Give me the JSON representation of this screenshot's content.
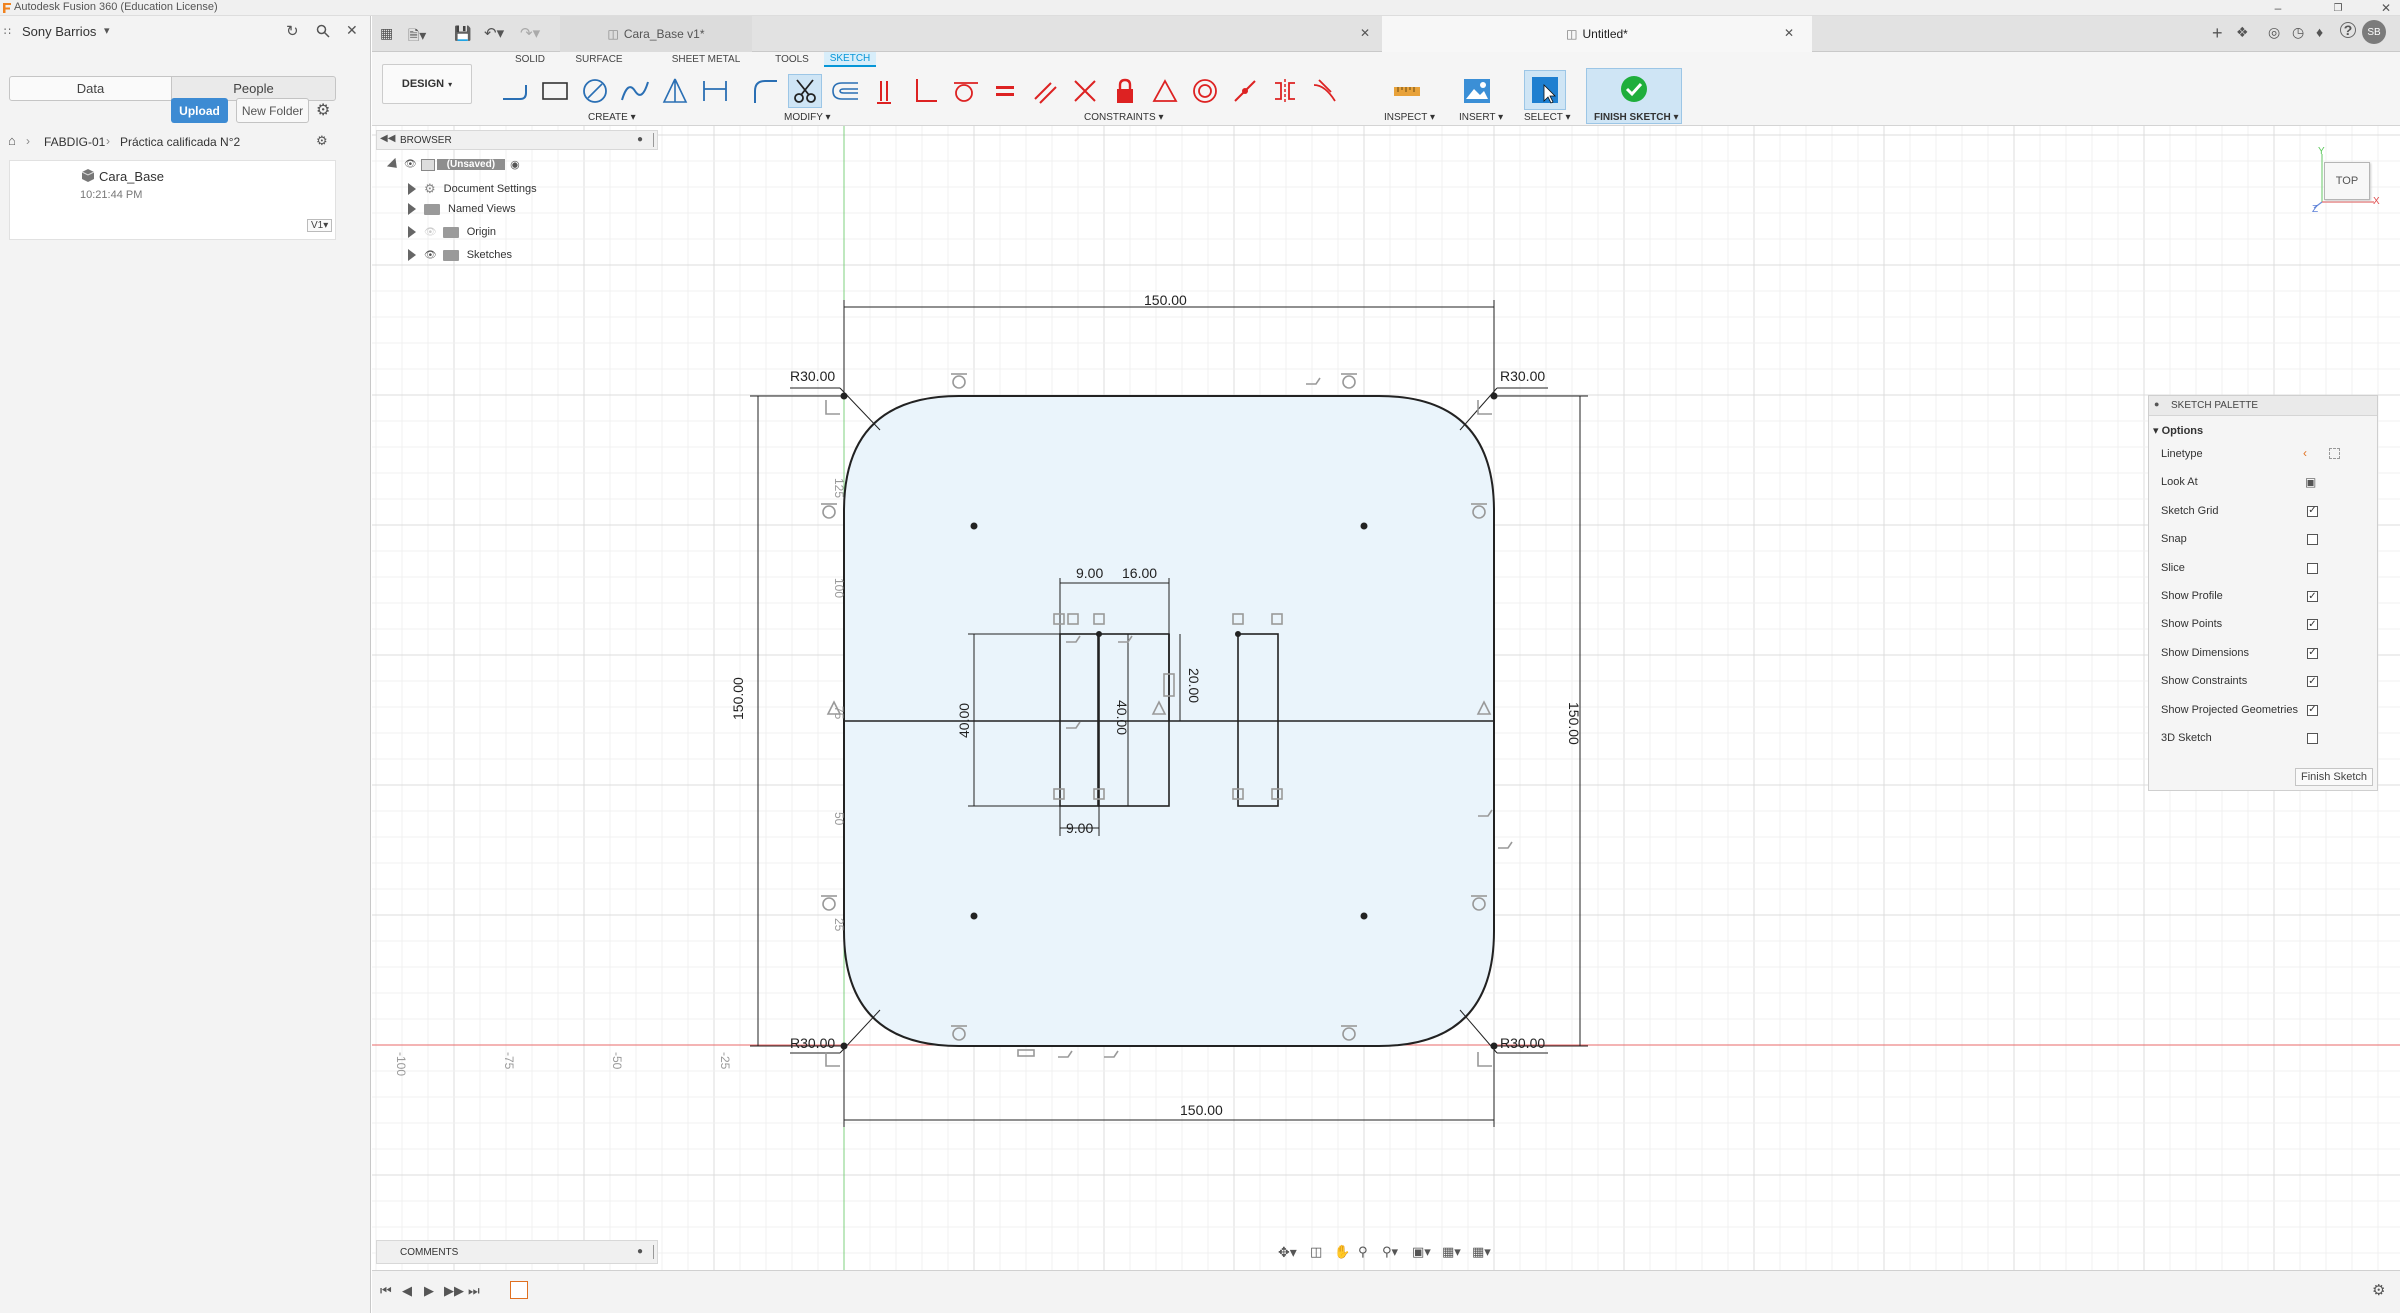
{
  "app": {
    "title": "Autodesk Fusion 360 (Education License)",
    "user": "Sony Barrios",
    "user_initials": "SB"
  },
  "datapanel": {
    "tabs": [
      "Data",
      "People"
    ],
    "upload_label": "Upload",
    "new_folder_label": "New Folder",
    "breadcrumb": [
      "FABDIG-01",
      "Práctica calificada N°2"
    ],
    "file": {
      "name": "Cara_Base",
      "time": "10:21:44 PM",
      "version": "V1"
    }
  },
  "tabs": {
    "doc1": "Cara_Base v1*",
    "doc2": "Untitled*"
  },
  "ribbon": {
    "workspace": "DESIGN",
    "tabs": [
      "SOLID",
      "SURFACE",
      "SHEET METAL",
      "TOOLS",
      "SKETCH"
    ],
    "active_tab": "SKETCH",
    "groups": {
      "create": "CREATE",
      "modify": "MODIFY",
      "constraints": "CONSTRAINTS",
      "inspect": "INSPECT",
      "insert": "INSERT",
      "select": "SELECT",
      "finish": "FINISH SKETCH"
    }
  },
  "browser": {
    "title": "BROWSER",
    "root": "(Unsaved)",
    "items": [
      "Document Settings",
      "Named Views",
      "Origin",
      "Sketches"
    ]
  },
  "viewcube": {
    "face": "TOP",
    "axis_x": "X",
    "axis_y": "Y",
    "axis_z": "Z"
  },
  "sketch": {
    "dims": {
      "width_top": "150.00",
      "width_bottom": "150.00",
      "height_left": "150.00",
      "height_right": "150.00",
      "r_tl": "R30.00",
      "r_tr": "R30.00",
      "r_bl": "R30.00",
      "r_br": "R30.00",
      "d9_top": "9.00",
      "d16": "16.00",
      "d9_bottom": "9.00",
      "d40_a": "40.00",
      "d40_b": "40.00",
      "d20": "20.00"
    },
    "inner_ruler": [
      "125",
      "100",
      "75",
      "50",
      "25"
    ],
    "x_ruler": [
      "-100",
      "-75",
      "-50",
      "-25"
    ]
  },
  "palette": {
    "title": "SKETCH PALETTE",
    "section": "Options",
    "rows": [
      {
        "label": "Linetype",
        "kind": "icons"
      },
      {
        "label": "Look At",
        "kind": "icon"
      },
      {
        "label": "Sketch Grid",
        "checked": true
      },
      {
        "label": "Snap",
        "checked": false
      },
      {
        "label": "Slice",
        "checked": false
      },
      {
        "label": "Show Profile",
        "checked": true
      },
      {
        "label": "Show Points",
        "checked": true
      },
      {
        "label": "Show Dimensions",
        "checked": true
      },
      {
        "label": "Show Constraints",
        "checked": true
      },
      {
        "label": "Show Projected Geometries",
        "checked": true
      },
      {
        "label": "3D Sketch",
        "checked": false
      }
    ],
    "finish_label": "Finish Sketch"
  },
  "comments": {
    "title": "COMMENTS"
  },
  "colors": {
    "accent": "#0696d7",
    "finish_green": "#1fae3c",
    "profile_fill": "#eaf4fb",
    "x_axis": "#e05050",
    "y_axis": "#5cc85c"
  }
}
